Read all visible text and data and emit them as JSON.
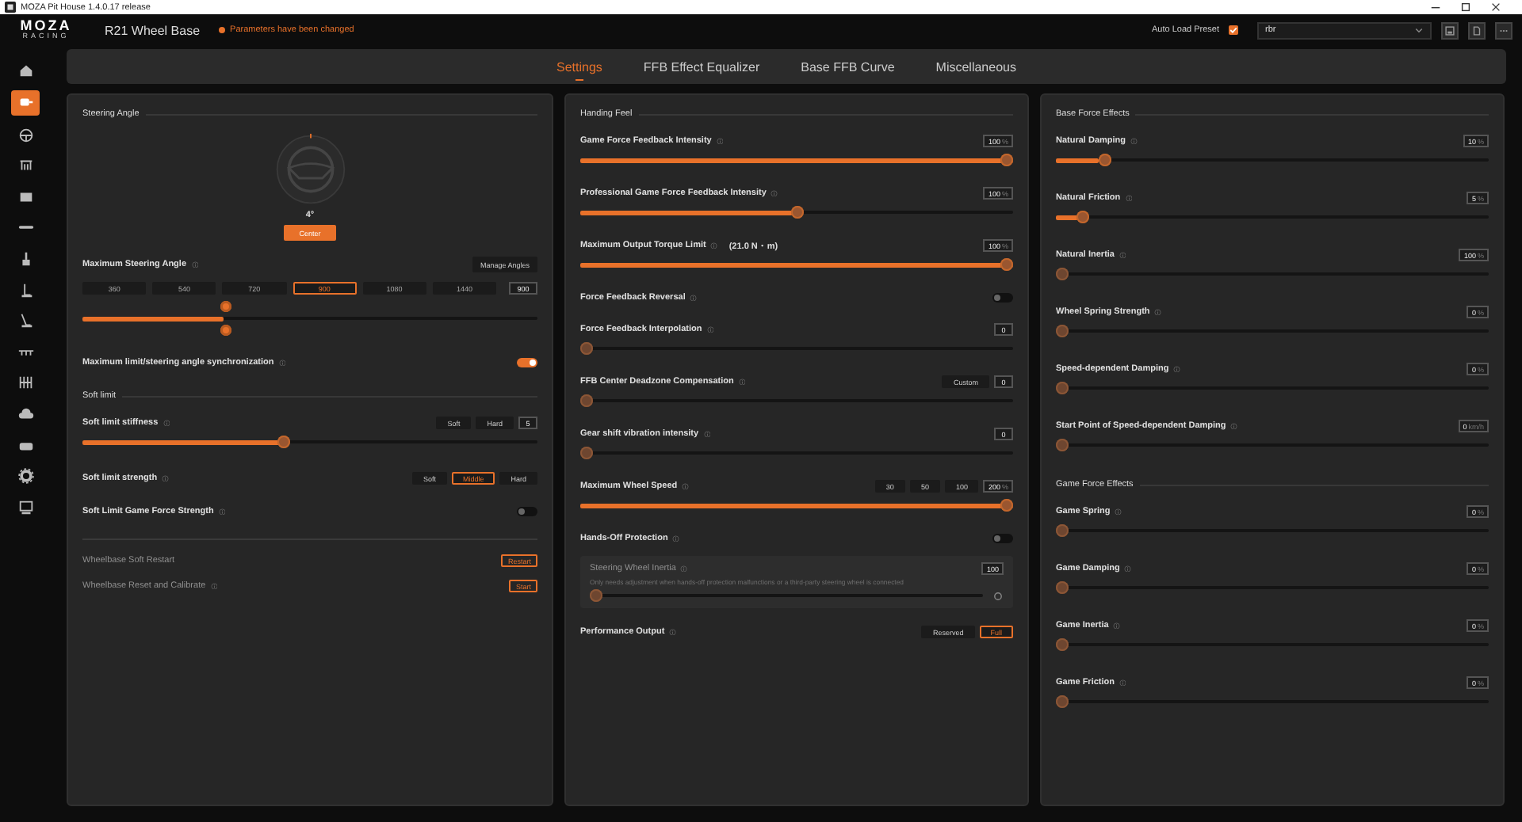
{
  "window": {
    "title": "MOZA Pit House 1.4.0.17 release"
  },
  "header": {
    "logo": "MOZA",
    "logo_sub": "RACING",
    "device": "R21 Wheel Base",
    "status": "Parameters have been changed",
    "auto_load_label": "Auto Load Preset",
    "auto_load_checked": true,
    "preset": "rbr"
  },
  "sidebar": {
    "items": [
      {
        "kind": "home",
        "selected": false
      },
      {
        "kind": "motor",
        "selected": true
      },
      {
        "kind": "steering",
        "selected": false
      },
      {
        "kind": "pedals",
        "selected": false
      },
      {
        "kind": "dash",
        "selected": false
      },
      {
        "kind": "bar",
        "selected": false
      },
      {
        "kind": "handbrake",
        "selected": false
      },
      {
        "kind": "lever",
        "selected": false
      },
      {
        "kind": "shifter",
        "selected": false
      },
      {
        "kind": "ruler",
        "selected": false
      },
      {
        "kind": "grid",
        "selected": false
      },
      {
        "kind": "cloud",
        "selected": false
      },
      {
        "kind": "drive",
        "selected": false
      },
      {
        "kind": "gear",
        "selected": false
      },
      {
        "kind": "remote",
        "selected": false
      }
    ]
  },
  "tabs": [
    {
      "label": "Settings",
      "selected": true
    },
    {
      "label": "FFB Effect Equalizer",
      "selected": false
    },
    {
      "label": "Base FFB Curve",
      "selected": false
    },
    {
      "label": "Miscellaneous",
      "selected": false
    }
  ],
  "panels": [
    {
      "items": [
        {
          "kind": "section",
          "label": "Steering Angle"
        },
        {
          "kind": "wheel",
          "angle": "4°",
          "button": "Center"
        },
        {
          "kind": "angle",
          "label": "Maximum Steering Angle",
          "info": true,
          "button": "Manage Angles",
          "options": [
            {
              "label": "360",
              "selected": false
            },
            {
              "label": "540",
              "selected": false
            },
            {
              "label": "720",
              "selected": false
            },
            {
              "label": "900",
              "selected": true
            },
            {
              "label": "1080",
              "selected": false
            },
            {
              "label": "1440",
              "selected": false
            }
          ],
          "value": "900",
          "level": 0.31
        },
        {
          "kind": "toggle",
          "label": "Maximum limit/steering angle synchronization",
          "info": true,
          "on": true
        },
        {
          "kind": "section",
          "label": "Soft limit"
        },
        {
          "kind": "slider",
          "label": "Soft limit stiffness",
          "info": true,
          "options": [
            {
              "label": "Soft",
              "selected": false
            },
            {
              "label": "Hard",
              "selected": false
            }
          ],
          "value": "5",
          "level": 0.44
        },
        {
          "kind": "choice",
          "label": "Soft limit strength",
          "info": true,
          "options": [
            {
              "label": "Soft",
              "selected": false
            },
            {
              "label": "Middle",
              "selected": true
            },
            {
              "label": "Hard",
              "selected": false
            }
          ]
        },
        {
          "kind": "toggle",
          "label": "Soft Limit Game Force Strength",
          "info": true,
          "on": false
        },
        {
          "kind": "action",
          "label": "Wheelbase Soft Restart",
          "button": "Restart"
        },
        {
          "kind": "action",
          "label": "Wheelbase Reset and Calibrate",
          "info": true,
          "button": "Start"
        }
      ]
    },
    {
      "items": [
        {
          "kind": "section",
          "label": "Handing Feel"
        },
        {
          "kind": "slider",
          "label": "Game Force Feedback Intensity",
          "info": true,
          "value": "100",
          "unit": "%",
          "level": 1
        },
        {
          "kind": "slider",
          "label": "Professional Game Force Feedback Intensity",
          "info": true,
          "value": "100",
          "unit": "%",
          "level": 0.5
        },
        {
          "kind": "slider",
          "label": "Maximum Output Torque Limit",
          "info": true,
          "note": "(21.0 N・m)",
          "value": "100",
          "unit": "%",
          "level": 1
        },
        {
          "kind": "toggle",
          "label": "Force Feedback Reversal",
          "info": true,
          "on": false
        },
        {
          "kind": "slider",
          "label": "Force Feedback Interpolation",
          "info": true,
          "value": "0",
          "level": 0
        },
        {
          "kind": "slider",
          "label": "FFB Center Deadzone Compensation",
          "info": true,
          "options": [
            {
              "label": "Custom",
              "selected": false
            }
          ],
          "value": "0",
          "level": 0
        },
        {
          "kind": "slider",
          "label": "Gear shift vibration intensity",
          "info": true,
          "value": "0",
          "level": 0
        },
        {
          "kind": "slider",
          "label": "Maximum Wheel Speed",
          "info": true,
          "options": [
            {
              "label": "30",
              "selected": false
            },
            {
              "label": "50",
              "selected": false
            },
            {
              "label": "100",
              "selected": false
            }
          ],
          "value": "200",
          "unit": "%",
          "level": 1
        },
        {
          "kind": "toggle",
          "label": "Hands-Off Protection",
          "info": true,
          "on": false
        },
        {
          "kind": "subpanel",
          "label": "Steering Wheel Inertia",
          "info": true,
          "value": "100",
          "note": "Only needs adjustment when hands-off protection malfunctions or a third-party steering wheel is connected",
          "level": 0
        },
        {
          "kind": "choice",
          "label": "Performance Output",
          "info": true,
          "options": [
            {
              "label": "Reserved",
              "selected": false
            },
            {
              "label": "Full",
              "selected": true
            }
          ]
        }
      ]
    },
    {
      "items": [
        {
          "kind": "section",
          "label": "Base Force Effects"
        },
        {
          "kind": "slider",
          "label": "Natural Damping",
          "info": true,
          "value": "10",
          "unit": "%",
          "level": 0.1
        },
        {
          "kind": "slider",
          "label": "Natural Friction",
          "info": true,
          "value": "5",
          "unit": "%",
          "level": 0.05
        },
        {
          "kind": "slider",
          "label": "Natural Inertia",
          "info": true,
          "value": "100",
          "unit": "%",
          "level": 0
        },
        {
          "kind": "slider",
          "label": "Wheel Spring Strength",
          "info": true,
          "value": "0",
          "unit": "%",
          "level": 0
        },
        {
          "kind": "slider",
          "label": "Speed-dependent Damping",
          "info": true,
          "value": "0",
          "unit": "%",
          "level": 0
        },
        {
          "kind": "slider",
          "label": "Start Point of Speed-dependent Damping",
          "info": true,
          "value": "0",
          "unit": "km/h",
          "level": 0
        },
        {
          "kind": "section",
          "label": "Game Force Effects"
        },
        {
          "kind": "slider",
          "label": "Game Spring",
          "info": true,
          "value": "0",
          "unit": "%",
          "level": 0
        },
        {
          "kind": "slider",
          "label": "Game Damping",
          "info": true,
          "value": "0",
          "unit": "%",
          "level": 0
        },
        {
          "kind": "slider",
          "label": "Game Inertia",
          "info": true,
          "value": "0",
          "unit": "%",
          "level": 0
        },
        {
          "kind": "slider",
          "label": "Game Friction",
          "info": true,
          "value": "0",
          "unit": "%",
          "level": 0
        }
      ]
    }
  ]
}
